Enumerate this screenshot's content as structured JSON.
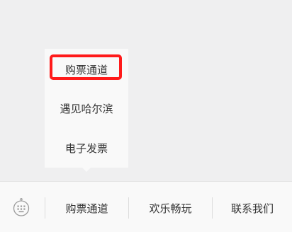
{
  "submenu": {
    "items": [
      {
        "label": "购票通道",
        "highlighted": true
      },
      {
        "label": "遇见哈尔滨"
      },
      {
        "label": "电子发票"
      }
    ]
  },
  "menubar": {
    "keyboard_icon": "keyboard-toggle-icon",
    "items": [
      {
        "label": "购票通道"
      },
      {
        "label": "欢乐畅玩"
      },
      {
        "label": "联系我们"
      }
    ]
  },
  "colors": {
    "background": "#efeff0",
    "menu_bg": "#f9f9f9",
    "highlight": "#ff1a1a",
    "text": "#333333"
  }
}
